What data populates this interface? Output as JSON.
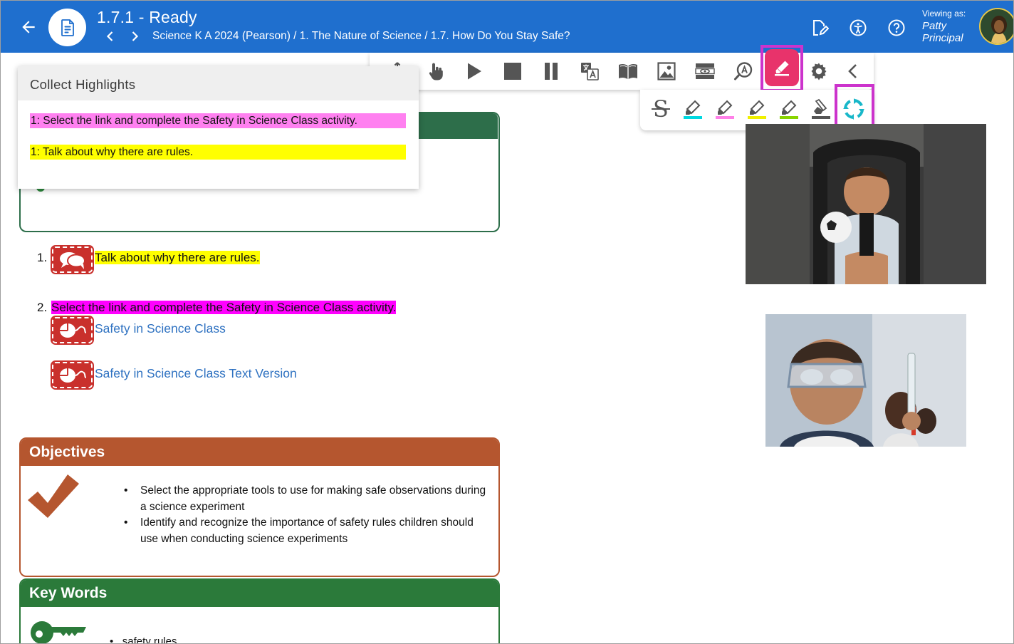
{
  "header": {
    "title": "1.7.1 - Ready",
    "breadcrumb": "Science K A 2024 (Pearson) / 1. The Nature of Science / 1.7. How Do You Stay Safe?",
    "viewing_label": "Viewing as:",
    "viewing_first": "Patty",
    "viewing_last": "Principal",
    "icons": [
      "back-arrow-icon",
      "document-icon",
      "chevron-left-icon",
      "chevron-right-icon",
      "edit-document-icon",
      "accessibility-icon",
      "help-icon"
    ]
  },
  "toolbar": {
    "buttons": [
      "move-icon",
      "hand-pointer-icon",
      "play-icon",
      "stop-icon",
      "pause-icon",
      "translate-icon",
      "dictionary-icon",
      "picture-dictionary-icon",
      "screen-mask-icon",
      "talk-and-type-icon",
      "highlighter-icon",
      "settings-icon",
      "collapse-icon"
    ],
    "active": "highlighter-icon",
    "accent_color": "#e8336b",
    "annotation_color": "#cc33cc"
  },
  "highlighter_bar": {
    "buttons": [
      "strikethrough-icon",
      "highlighter-cyan-icon",
      "highlighter-pink-icon",
      "highlighter-yellow-icon",
      "highlighter-green-icon",
      "eraser-icon",
      "collect-highlights-icon"
    ],
    "colors": [
      "#00d8e0",
      "#ff80e8",
      "#f0f000",
      "#88d400"
    ]
  },
  "collect_panel": {
    "title": "Collect Highlights",
    "items": [
      {
        "text": "1: Select the link and complete the Safety in Science Class activity.",
        "color": "#ff80f0"
      },
      {
        "text": "1: Talk about why there are rules.",
        "color": "#ffff00"
      }
    ]
  },
  "content": {
    "steps": [
      {
        "number": "1.",
        "text": "Talk about why there are rules.",
        "highlight": "#ffff00"
      },
      {
        "number": "2.",
        "text": "Select the link and complete the Safety in Science Class activity.",
        "highlight": "#ff00ff"
      }
    ],
    "links": [
      "Safety in Science Class",
      "Safety in Science Class Text Version"
    ],
    "objectives": {
      "title": "Objectives",
      "items": [
        "Select the appropriate tools to use for making safe observations during a science experiment",
        "Identify and recognize the importance of safety rules children should use when conducting science experiments"
      ]
    },
    "key_words": {
      "title": "Key Words",
      "items": [
        "safety rules"
      ]
    }
  }
}
